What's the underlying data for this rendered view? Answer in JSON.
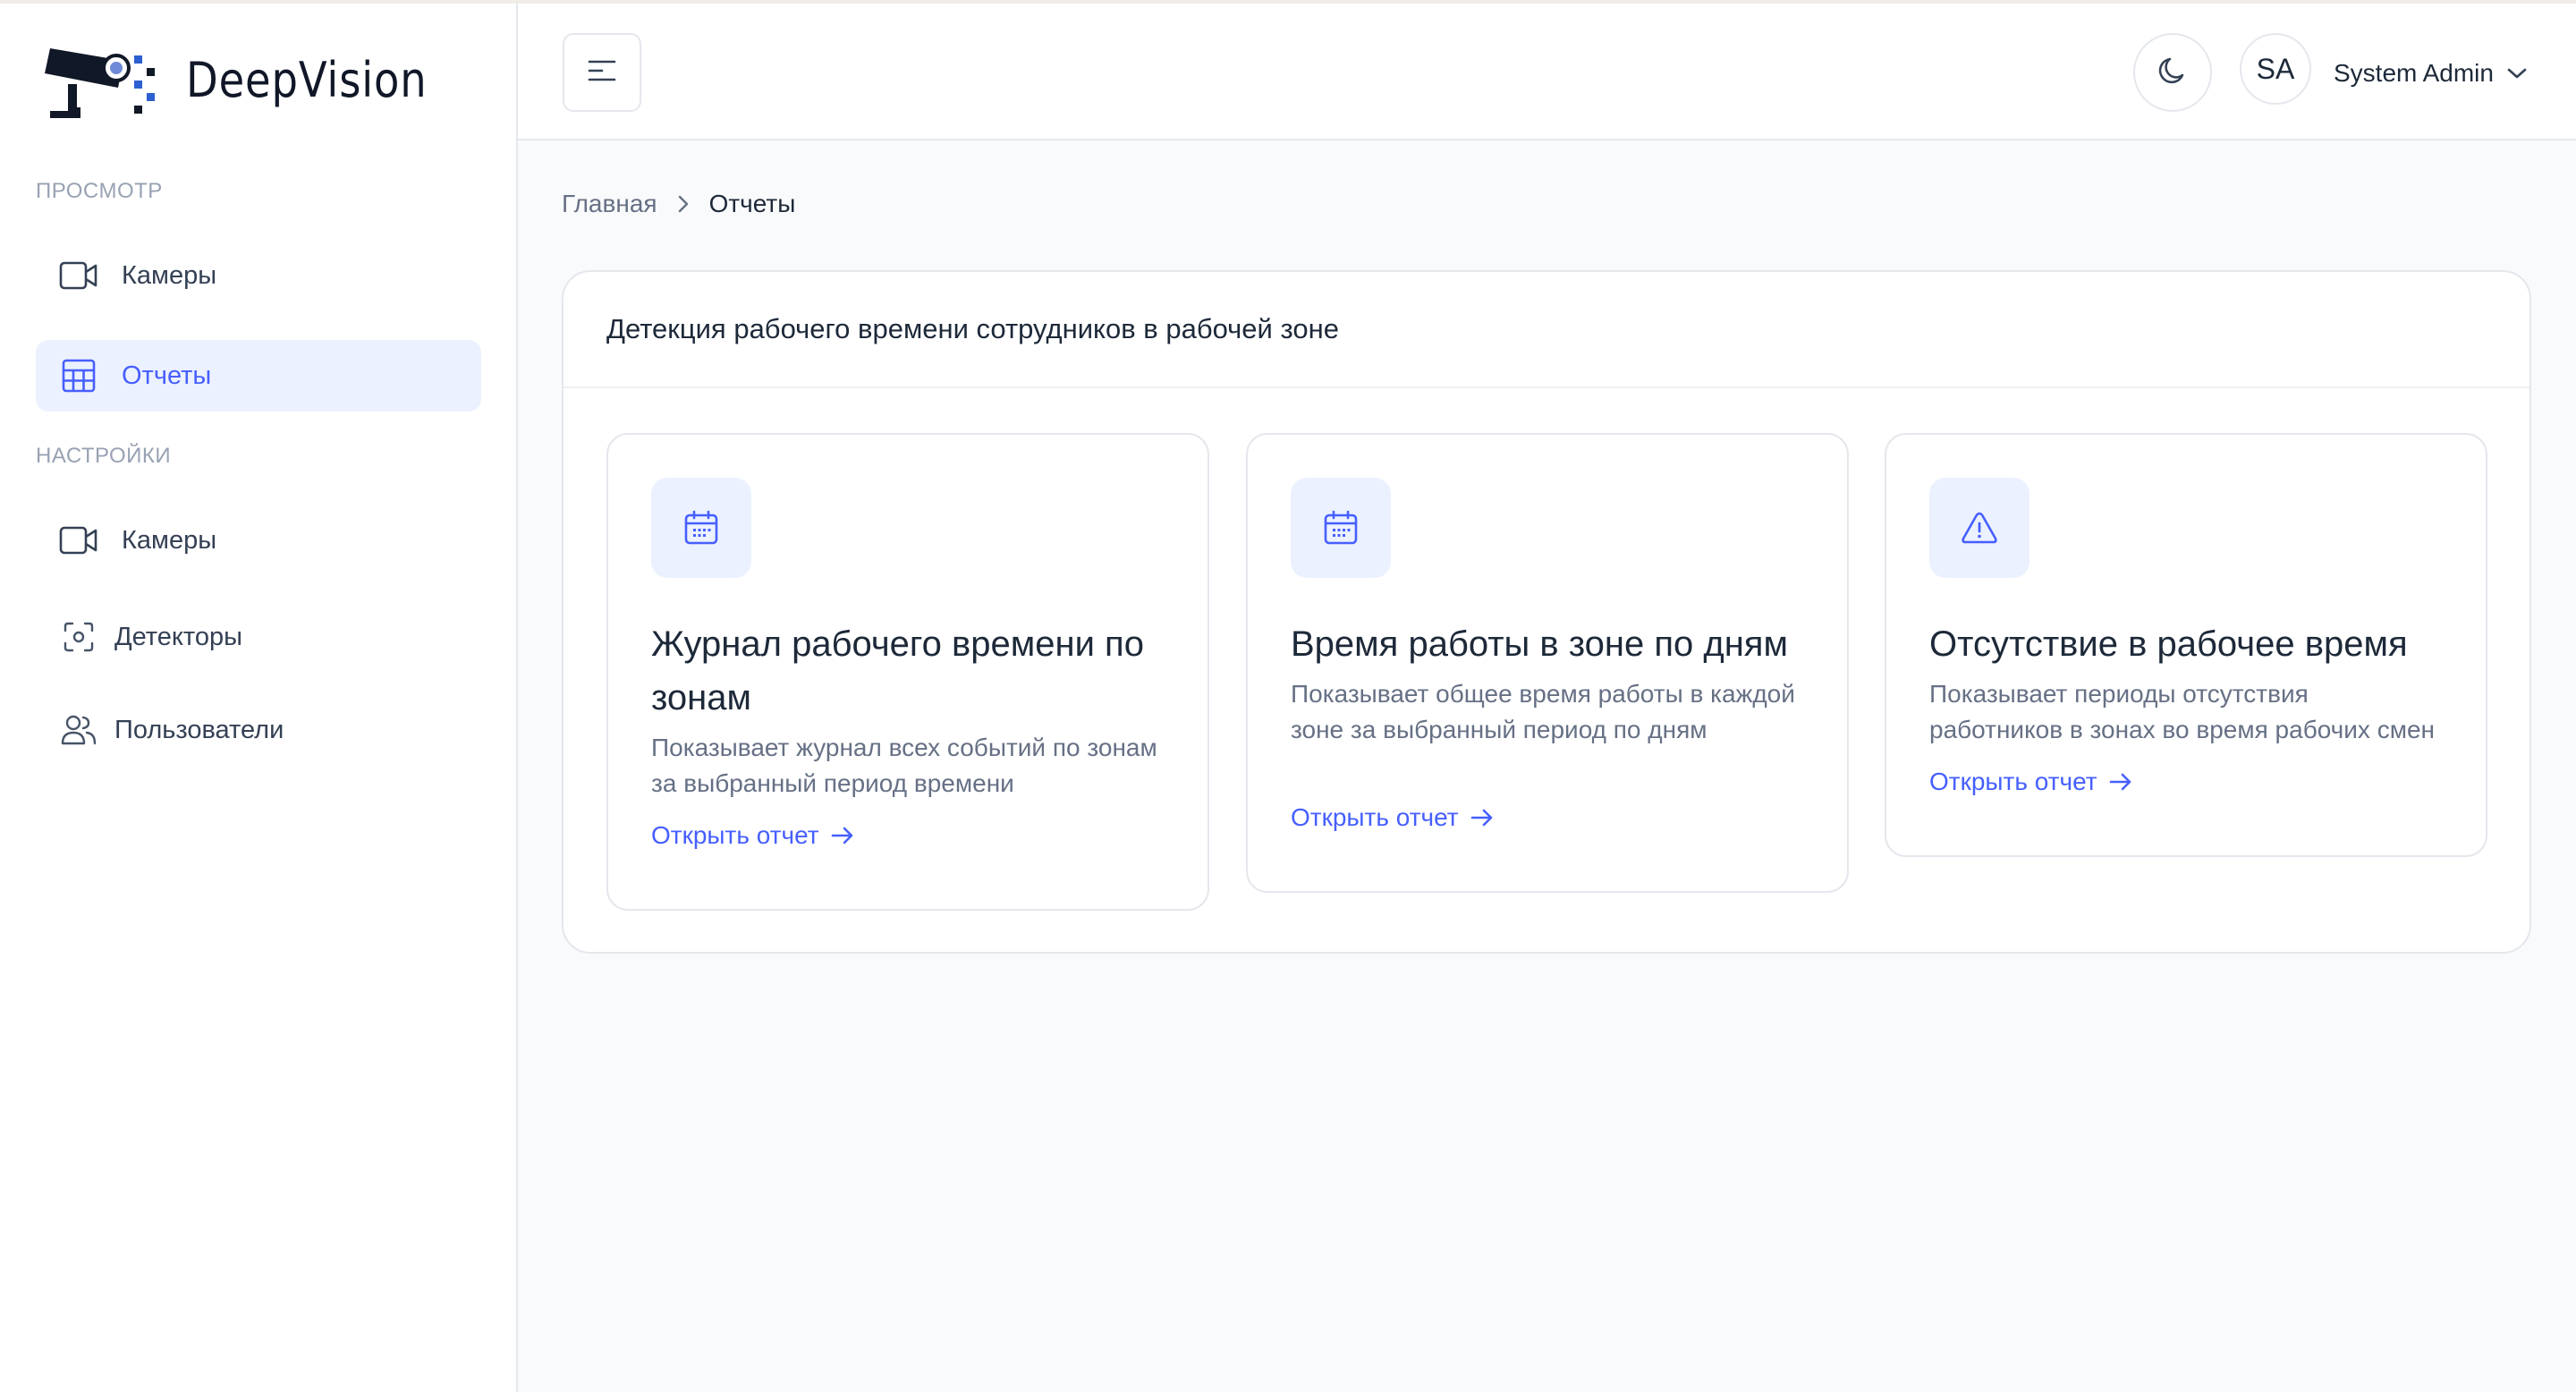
{
  "brand": {
    "name": "DeepVision"
  },
  "sidebar": {
    "sections": [
      {
        "label": "ПРОСМОТР"
      },
      {
        "label": "НАСТРОЙКИ"
      }
    ],
    "items": [
      {
        "label": "Камеры",
        "icon": "video-camera-icon"
      },
      {
        "label": "Отчеты",
        "icon": "table-grid-icon",
        "active": true
      },
      {
        "label": "Камеры",
        "icon": "video-camera-icon"
      },
      {
        "label": "Детекторы",
        "icon": "scan-focus-icon"
      },
      {
        "label": "Пользователи",
        "icon": "users-icon"
      }
    ]
  },
  "header": {
    "menu_icon": "menu-lines-icon",
    "theme_icon": "moon-icon",
    "user": {
      "initials": "SA",
      "name": "System Admin"
    }
  },
  "breadcrumb": {
    "home": "Главная",
    "current": "Отчеты"
  },
  "panel": {
    "title": "Детекция рабочего времени сотрудников в рабочей зоне",
    "cards": [
      {
        "icon": "calendar-icon",
        "title": "Журнал рабочего времени по зонам",
        "description": "Показывает журнал всех событий по зонам за выбранный период времени",
        "link": "Открыть отчет"
      },
      {
        "icon": "calendar-icon",
        "title": "Время работы в зоне по дням",
        "description": "Показывает общее время работы в каждой зоне за выбранный период по дням",
        "link": "Открыть отчет"
      },
      {
        "icon": "warning-triangle-icon",
        "title": "Отсутствие в рабочее время",
        "description": "Показывает периоды отсутствия работников в зонах во время рабочих смен",
        "link": "Открыть отчет"
      }
    ]
  },
  "colors": {
    "accent": "#465fff",
    "active_bg": "#ecf1ff",
    "muted_text": "#667085",
    "border": "#e4e7ec"
  }
}
